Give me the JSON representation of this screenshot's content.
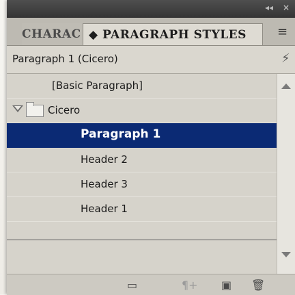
{
  "panel": {
    "title_controls": {
      "collapse": "◂◂",
      "close": "×"
    },
    "tabs": [
      {
        "label": "CHARAC",
        "active": false
      },
      {
        "label": "◆ PARAGRAPH STYLES",
        "active": true
      }
    ],
    "panel_menu_icon": "panel-menu-icon",
    "current_style": "Paragraph 1 (Cicero)",
    "quick_apply_icon": "lightning-icon"
  },
  "list": {
    "items": [
      {
        "label": "[Basic Paragraph]",
        "type": "style"
      },
      {
        "label": "Cicero",
        "type": "group"
      },
      {
        "label": "Paragraph 1",
        "type": "style",
        "selected": true
      },
      {
        "label": "Header 2",
        "type": "style"
      },
      {
        "label": "Header 3",
        "type": "style"
      },
      {
        "label": "Header 1",
        "type": "style"
      }
    ]
  },
  "bottom_icons": [
    {
      "name": "new-group-icon"
    },
    {
      "name": "new-paragraph-style-icon"
    },
    {
      "name": "new-style-icon"
    },
    {
      "name": "delete-style-icon"
    }
  ],
  "colors": {
    "selection": "#0b2a74",
    "panel": "#d6d3cb"
  }
}
